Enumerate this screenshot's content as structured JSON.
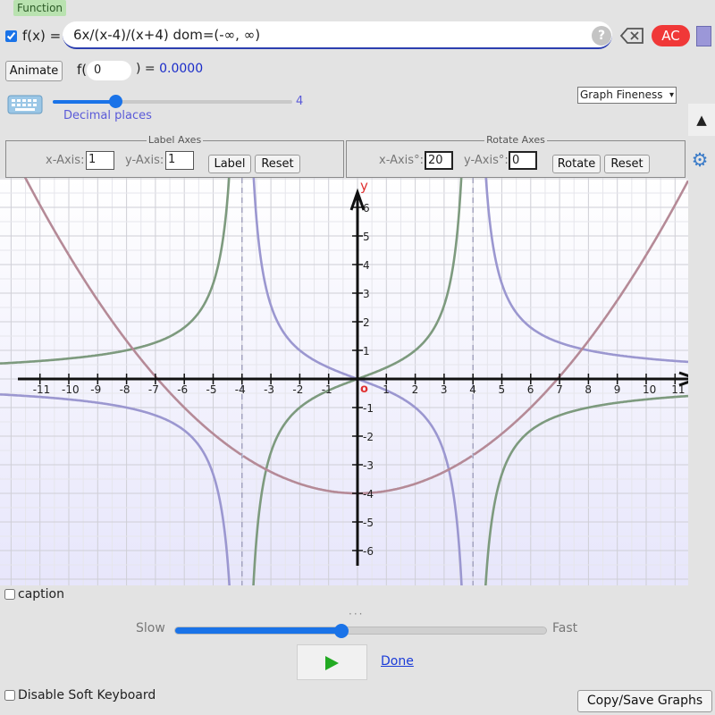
{
  "function_tab": {
    "label": "Function"
  },
  "expression": {
    "label": "f(x) =",
    "value": "6x/(x-4)/(x+4)  dom=(-∞, ∞)",
    "help": "?",
    "clear_label": "AC",
    "swatch_color": "#9b97d8"
  },
  "evaluate": {
    "animate_label": "Animate",
    "f_open": "f(",
    "input_value": "0",
    "result_prefix": ") =",
    "result_value": "0.0000"
  },
  "decimals": {
    "value": "4",
    "label": "Decimal places",
    "slider_fraction": 0.27
  },
  "fineness": {
    "selected": "Graph Fineness"
  },
  "label_axes": {
    "legend": "Label Axes",
    "x_label": "x-Axis:",
    "x_value": "1",
    "y_label": "y-Axis:",
    "y_value": "1",
    "label_button": "Label",
    "reset_button": "Reset"
  },
  "rotate_axes": {
    "legend": "Rotate Axes",
    "x_label": "x-Axis°:",
    "x_value": "20",
    "y_label": "y-Axis°:",
    "y_value": "0",
    "rotate_button": "Rotate",
    "reset_button": "Reset"
  },
  "graph": {
    "x_axis_name": "x",
    "y_axis_name": "y",
    "origin_label": "o",
    "x_range": [
      -12.4,
      12.0
    ],
    "y_range": [
      -6.6,
      6.5
    ],
    "x_ticks": [
      -11,
      -10,
      -9,
      -8,
      -7,
      -6,
      -5,
      -4,
      -3,
      -2,
      -1,
      1,
      2,
      3,
      4,
      5,
      6,
      7,
      8,
      9,
      10,
      11
    ],
    "y_ticks": [
      -6,
      -5,
      -4,
      -3,
      -2,
      -1,
      1,
      2,
      3,
      4,
      5,
      6
    ],
    "asymptotes_x": [
      -4,
      4
    ],
    "curves": [
      {
        "expr": "6x/((x-4)(x+4))",
        "color": "#9b97d0"
      },
      {
        "expr": "-6x/((x-4)(x+4))",
        "color": "#7d9a7e"
      },
      {
        "expr": "x^2/12 - 4",
        "color": "#b58a97"
      }
    ]
  },
  "caption": {
    "label": "caption"
  },
  "speed": {
    "slow_label": "Slow",
    "fast_label": "Fast",
    "fraction": 0.44,
    "done_label": "Done"
  },
  "footer": {
    "soft_keyboard_label": "Disable Soft Keyboard",
    "copy_save_label": "Copy/Save Graphs"
  }
}
